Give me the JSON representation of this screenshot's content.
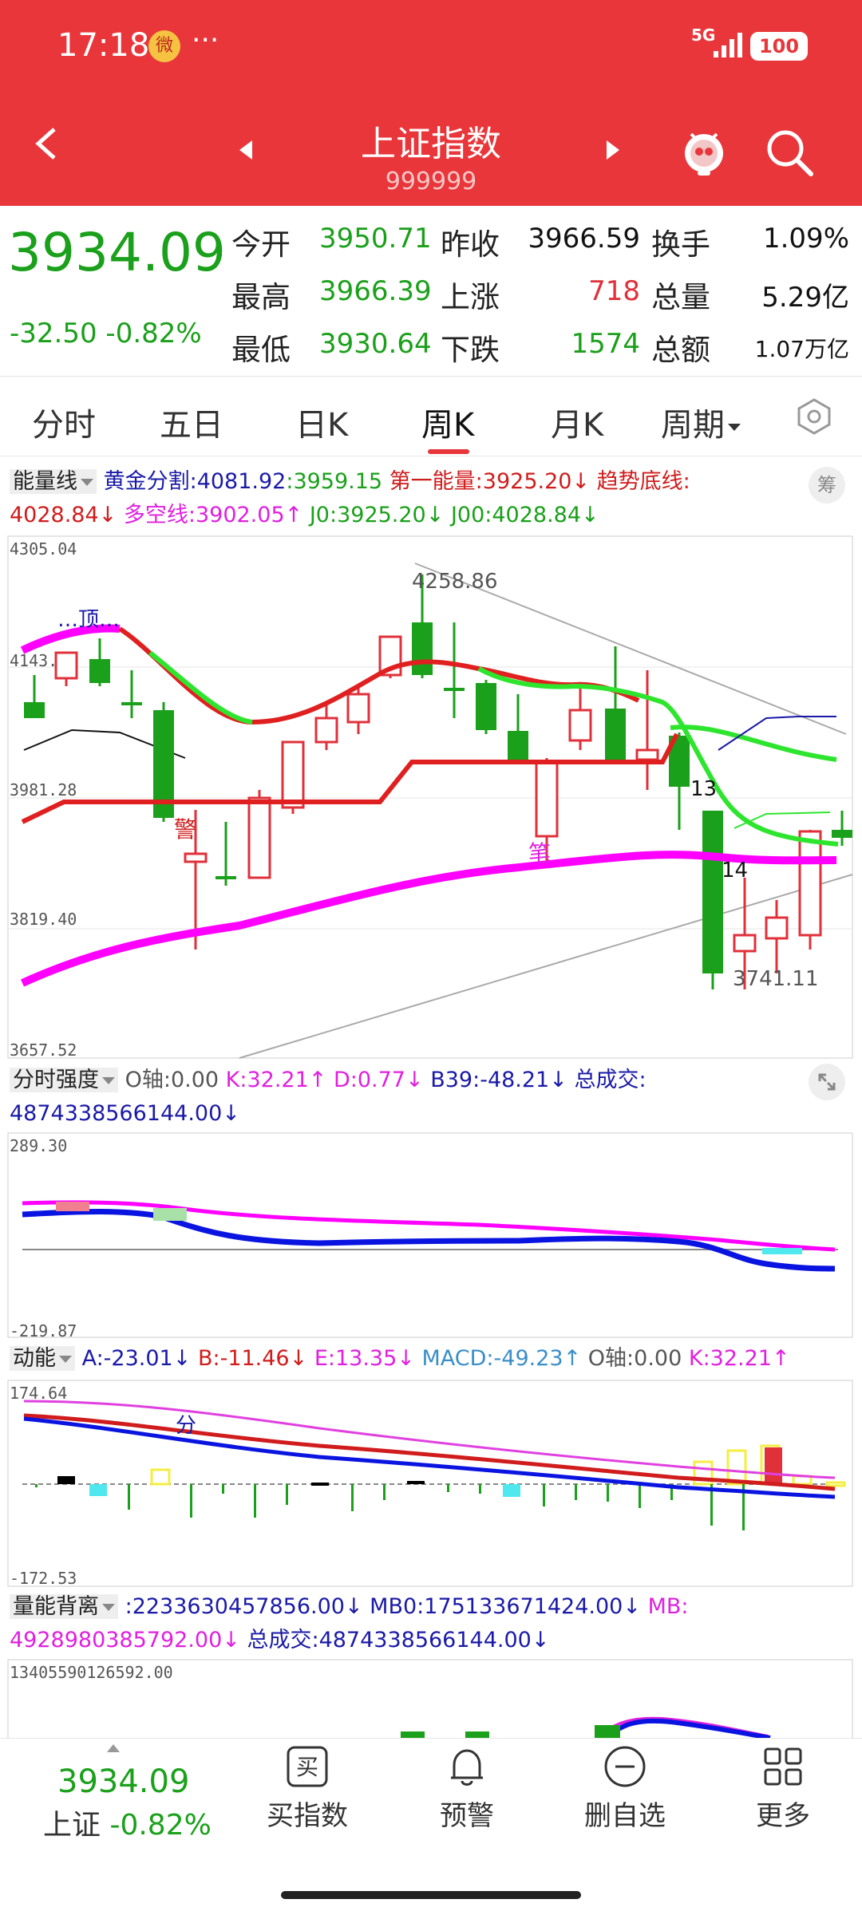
{
  "status_bar": {
    "time": "17:18",
    "app_badge": "微",
    "more": "···",
    "network": "5G",
    "battery": "100"
  },
  "header": {
    "title": "上证指数",
    "code": "999999"
  },
  "quote": {
    "price": "3934.09",
    "change": "-32.50",
    "change_pct": "-0.82%",
    "rows": [
      {
        "label1": "今开",
        "value1": "3950.71",
        "label2": "昨收",
        "value2": "3966.59",
        "label3": "换手",
        "value3": "1.09%"
      },
      {
        "label1": "最高",
        "value1": "3966.39",
        "label2": "上涨",
        "value2": "718",
        "label3": "总量",
        "value3": "5.29亿"
      },
      {
        "label1": "最低",
        "value1": "3930.64",
        "label2": "下跌",
        "value2": "1574",
        "label3": "总额",
        "value3": "1.07万亿"
      }
    ]
  },
  "tabs": [
    {
      "label": "分时"
    },
    {
      "label": "五日"
    },
    {
      "label": "日K"
    },
    {
      "label": "周K",
      "active": true
    },
    {
      "label": "月K"
    },
    {
      "label": "周期"
    }
  ],
  "panel1": {
    "name": "能量线",
    "chip": "筹",
    "line1": [
      {
        "text": "黄金分割:4081.92",
        "color": "#1a1aa8"
      },
      {
        "text": ":3959.15",
        "color": "#1aa01a"
      },
      {
        "text": "第一能量:3925.20↓",
        "color": "#d01c1c"
      },
      {
        "text": "趋势底线:",
        "color": "#d01c1c"
      }
    ],
    "line2": [
      {
        "text": "4028.84↓",
        "color": "#d01c1c"
      },
      {
        "text": "多空线:3902.05↑",
        "color": "#e020e0"
      },
      {
        "text": "J0:3925.20↓",
        "color": "#1aa01a"
      },
      {
        "text": "J00:4028.84↓",
        "color": "#1aa01a"
      }
    ],
    "axis": [
      "4305.04",
      "4143.16",
      "3981.28",
      "3819.40",
      "3657.52"
    ],
    "annotations": {
      "top": "…顶…",
      "high": "4258.86",
      "low": "3741.11",
      "jing": "警",
      "bi": "笔",
      "n13": "13",
      "n14": "14"
    }
  },
  "panel2": {
    "name": "分时强度",
    "line1": [
      {
        "text": "O轴:0.00",
        "color": "#555"
      },
      {
        "text": "K:32.21↑",
        "color": "#e020e0"
      },
      {
        "text": "D:0.77↓",
        "color": "#e020e0"
      },
      {
        "text": "B39:-48.21↓",
        "color": "#1a1aa8"
      },
      {
        "text": "总成交:",
        "color": "#1a1aa8"
      }
    ],
    "line2": [
      {
        "text": "4874338566144.00↓",
        "color": "#1a1aa8"
      }
    ],
    "axis": [
      "289.30",
      "-219.87"
    ]
  },
  "panel3": {
    "name": "动能",
    "line1": [
      {
        "text": "A:-23.01↓",
        "color": "#1a1aa8"
      },
      {
        "text": "B:-11.46↓",
        "color": "#d01c1c"
      },
      {
        "text": "E:13.35↓",
        "color": "#e020e0"
      },
      {
        "text": "MACD:-49.23↑",
        "color": "#3a8ec8"
      },
      {
        "text": "O轴:0.00",
        "color": "#555"
      },
      {
        "text": "K:32.21↑",
        "color": "#e020e0"
      }
    ],
    "axis": [
      "174.64",
      "-172.53"
    ],
    "annotation": "分"
  },
  "panel4": {
    "name": "量能背离",
    "line1": [
      {
        "text": ":2233630457856.00↓",
        "color": "#1a1aa8"
      },
      {
        "text": "MB0:175133671424.00↓",
        "color": "#1a1aa8"
      },
      {
        "text": "MB:",
        "color": "#e020e0"
      }
    ],
    "line2": [
      {
        "text": "4928980385792.00↓",
        "color": "#e020e0"
      },
      {
        "text": "总成交:4874338566144.00↓",
        "color": "#1a1aa8"
      }
    ],
    "axis": [
      "13405590126592.00"
    ]
  },
  "bottom_bar": {
    "price": "3934.09",
    "name": "上证",
    "pct": "-0.82%",
    "buttons": [
      {
        "label": "买指数",
        "icon": "buy-icon",
        "glyph": "买"
      },
      {
        "label": "预警",
        "icon": "bell-icon"
      },
      {
        "label": "删自选",
        "icon": "minus-circle-icon"
      },
      {
        "label": "更多",
        "icon": "grid-icon"
      }
    ]
  },
  "colors": {
    "header_bg": "#e8363a",
    "up": "#e0303a",
    "down": "#1aa01a"
  }
}
